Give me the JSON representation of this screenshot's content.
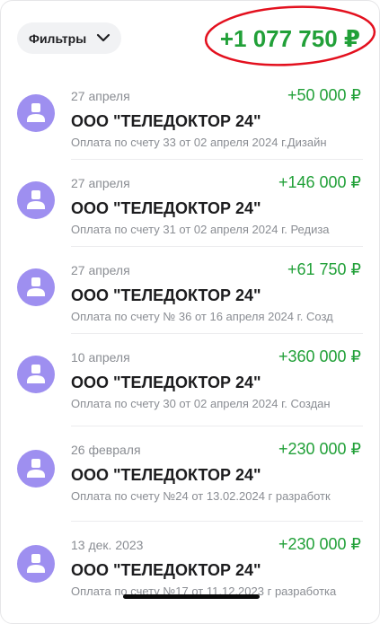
{
  "header": {
    "filter_label": "Фильтры",
    "total": "+1 077 750 ₽",
    "highlight_color": "#e3101e"
  },
  "accent_green": "#21a038",
  "avatar_color": "#9e8ff0",
  "transactions": [
    {
      "date": "27 апреля",
      "amount": "+50 000 ₽",
      "name": "ООО \"ТЕЛЕДОКТОР 24\"",
      "desc": "Оплата по счету 33 от 02 апреля 2024 г.Дизайн"
    },
    {
      "date": "27 апреля",
      "amount": "+146 000 ₽",
      "name": "ООО \"ТЕЛЕДОКТОР 24\"",
      "desc": "Оплата по счету 31 от 02 апреля 2024 г. Редиза"
    },
    {
      "date": "27 апреля",
      "amount": "+61 750 ₽",
      "name": "ООО \"ТЕЛЕДОКТОР 24\"",
      "desc": "Оплата по счету № 36 от 16 апреля 2024 г. Созд"
    },
    {
      "date": "10 апреля",
      "amount": "+360 000 ₽",
      "name": "ООО \"ТЕЛЕДОКТОР 24\"",
      "desc": "Оплата по счету 30 от 02 апреля 2024 г. Создан"
    },
    {
      "date": "26 февраля",
      "amount": "+230 000 ₽",
      "name": "ООО \"ТЕЛЕДОКТОР 24\"",
      "desc": "Оплата по счету №24 от 13.02.2024 г разработк"
    },
    {
      "date": "13 дек. 2023",
      "amount": "+230 000 ₽",
      "name": "ООО \"ТЕЛЕДОКТОР 24\"",
      "desc": "Оплата по счету №17 от 11.12.2023 г разработка"
    }
  ]
}
